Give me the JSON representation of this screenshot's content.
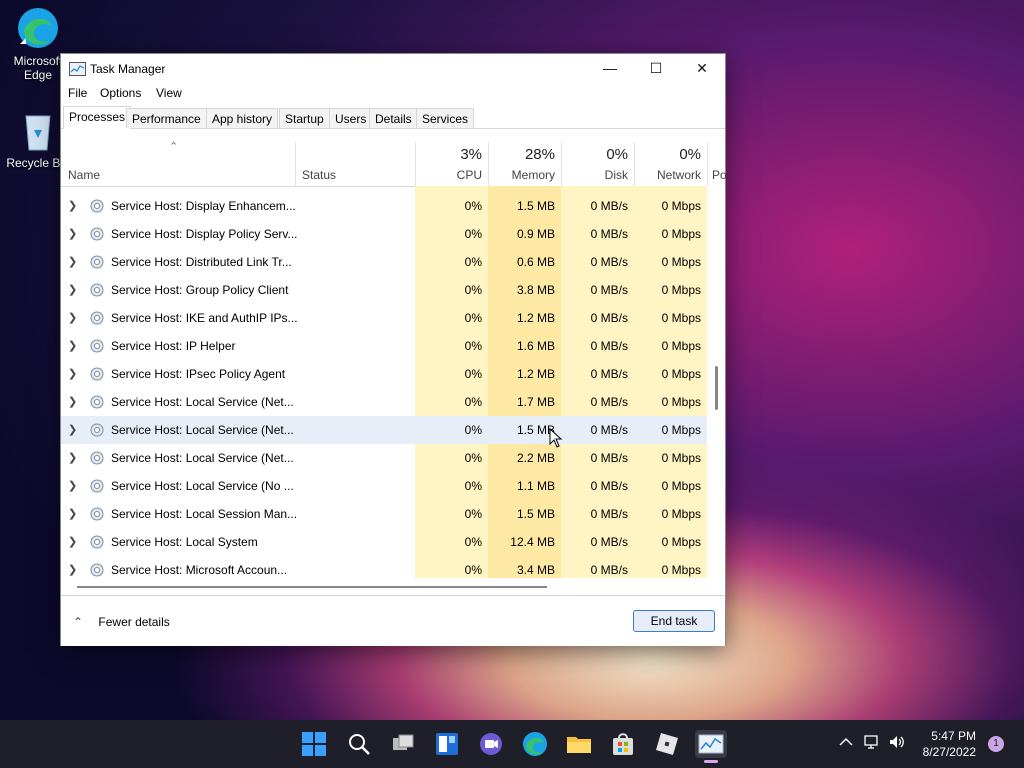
{
  "desktop": {
    "icons": [
      {
        "label": "Microsoft Edge"
      },
      {
        "label": "Recycle Bin"
      }
    ]
  },
  "window": {
    "title": "Task Manager",
    "menu": [
      "File",
      "Options",
      "View"
    ],
    "tabs": [
      "Processes",
      "Performance",
      "App history",
      "Startup",
      "Users",
      "Details",
      "Services"
    ],
    "active_tab": "Processes",
    "columns": {
      "name": "Name",
      "status": "Status",
      "cpu": {
        "pct": "3%",
        "label": "CPU"
      },
      "memory": {
        "pct": "28%",
        "label": "Memory"
      },
      "disk": {
        "pct": "0%",
        "label": "Disk"
      },
      "network": {
        "pct": "0%",
        "label": "Network"
      },
      "power": "Po"
    },
    "rows": [
      {
        "name": "Service Host: Display Enhancem...",
        "cpu": "0%",
        "memory": "1.5 MB",
        "disk": "0 MB/s",
        "network": "0 Mbps"
      },
      {
        "name": "Service Host: Display Policy Serv...",
        "cpu": "0%",
        "memory": "0.9 MB",
        "disk": "0 MB/s",
        "network": "0 Mbps"
      },
      {
        "name": "Service Host: Distributed Link Tr...",
        "cpu": "0%",
        "memory": "0.6 MB",
        "disk": "0 MB/s",
        "network": "0 Mbps"
      },
      {
        "name": "Service Host: Group Policy Client",
        "cpu": "0%",
        "memory": "3.8 MB",
        "disk": "0 MB/s",
        "network": "0 Mbps"
      },
      {
        "name": "Service Host: IKE and AuthIP IPs...",
        "cpu": "0%",
        "memory": "1.2 MB",
        "disk": "0 MB/s",
        "network": "0 Mbps"
      },
      {
        "name": "Service Host: IP Helper",
        "cpu": "0%",
        "memory": "1.6 MB",
        "disk": "0 MB/s",
        "network": "0 Mbps"
      },
      {
        "name": "Service Host: IPsec Policy Agent",
        "cpu": "0%",
        "memory": "1.2 MB",
        "disk": "0 MB/s",
        "network": "0 Mbps"
      },
      {
        "name": "Service Host: Local Service (Net...",
        "cpu": "0%",
        "memory": "1.7 MB",
        "disk": "0 MB/s",
        "network": "0 Mbps"
      },
      {
        "name": "Service Host: Local Service (Net...",
        "cpu": "0%",
        "memory": "1.5 MB",
        "disk": "0 MB/s",
        "network": "0 Mbps",
        "highlighted": true
      },
      {
        "name": "Service Host: Local Service (Net...",
        "cpu": "0%",
        "memory": "2.2 MB",
        "disk": "0 MB/s",
        "network": "0 Mbps"
      },
      {
        "name": "Service Host: Local Service (No ...",
        "cpu": "0%",
        "memory": "1.1 MB",
        "disk": "0 MB/s",
        "network": "0 Mbps"
      },
      {
        "name": "Service Host: Local Session Man...",
        "cpu": "0%",
        "memory": "1.5 MB",
        "disk": "0 MB/s",
        "network": "0 Mbps"
      },
      {
        "name": "Service Host: Local System",
        "cpu": "0%",
        "memory": "12.4 MB",
        "disk": "0 MB/s",
        "network": "0 Mbps"
      },
      {
        "name": "Service Host: Microsoft Accoun...",
        "cpu": "0%",
        "memory": "3.4 MB",
        "disk": "0 MB/s",
        "network": "0 Mbps"
      }
    ],
    "footer": {
      "fewer_details": "Fewer details",
      "end_task": "End task"
    }
  },
  "taskbar": {
    "clock_time": "5:47 PM",
    "clock_date": "8/27/2022",
    "notification_count": "1"
  }
}
